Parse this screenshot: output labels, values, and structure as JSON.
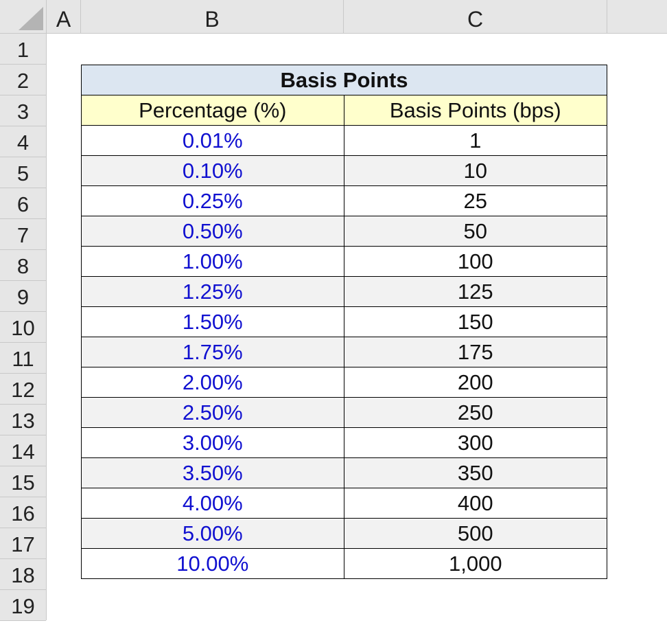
{
  "columns": [
    "A",
    "B",
    "C"
  ],
  "rows": [
    "1",
    "2",
    "3",
    "4",
    "5",
    "6",
    "7",
    "8",
    "9",
    "10",
    "11",
    "12",
    "13",
    "14",
    "15",
    "16",
    "17",
    "18",
    "19"
  ],
  "table": {
    "title": "Basis Points",
    "headers": [
      "Percentage (%)",
      "Basis Points (bps)"
    ],
    "data": [
      [
        "0.01%",
        "1"
      ],
      [
        "0.10%",
        "10"
      ],
      [
        "0.25%",
        "25"
      ],
      [
        "0.50%",
        "50"
      ],
      [
        "1.00%",
        "100"
      ],
      [
        "1.25%",
        "125"
      ],
      [
        "1.50%",
        "150"
      ],
      [
        "1.75%",
        "175"
      ],
      [
        "2.00%",
        "200"
      ],
      [
        "2.50%",
        "250"
      ],
      [
        "3.00%",
        "300"
      ],
      [
        "3.50%",
        "350"
      ],
      [
        "4.00%",
        "400"
      ],
      [
        "5.00%",
        "500"
      ],
      [
        "10.00%",
        "1,000"
      ]
    ]
  },
  "colors": {
    "percentage_text": "#1010d0",
    "title_fill": "#dce6f1",
    "header_fill": "#ffffcc",
    "alt_row_fill": "#f2f2f2"
  }
}
